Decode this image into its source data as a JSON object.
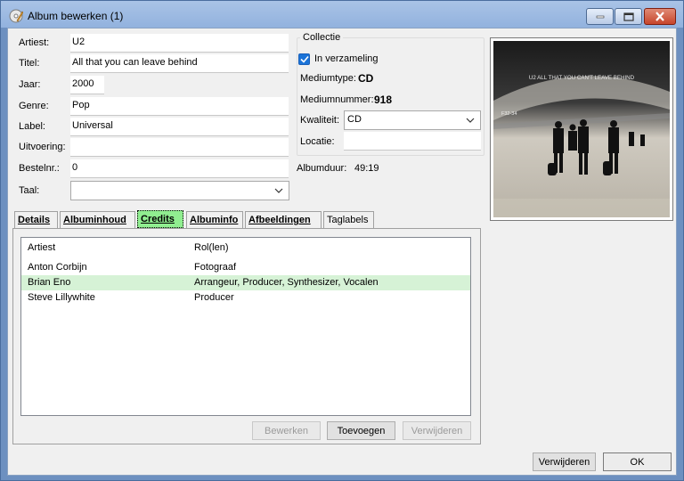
{
  "window": {
    "title": "Album bewerken (1)",
    "controls": {
      "minimize": "minimize",
      "maximize": "maximize",
      "close": "close"
    }
  },
  "form": {
    "artist_label": "Artiest:",
    "artist_value": "U2",
    "title_label": "Titel:",
    "title_value": "All that you can leave behind",
    "year_label": "Jaar:",
    "year_value": "2000",
    "genre_label": "Genre:",
    "genre_value": "Pop",
    "label_label": "Label:",
    "label_value": "Universal",
    "performance_label": "Uitvoering:",
    "performance_value": "",
    "ordernr_label": "Bestelnr.:",
    "ordernr_value": "0",
    "language_label": "Taal:",
    "language_value": ""
  },
  "collection": {
    "title": "Collectie",
    "in_collection_label": "In verzameling",
    "in_collection_checked": true,
    "media_type_label": "Mediumtype:",
    "media_type_value": "CD",
    "media_number_label": "Mediumnummer:",
    "media_number_value": "918",
    "quality_label": "Kwaliteit:",
    "quality_value": "CD",
    "location_label": "Locatie:",
    "location_value": ""
  },
  "duration": {
    "label": "Albumduur:",
    "value": "49:19"
  },
  "cover": {
    "caption": "U2 ALL THAT YOU CAN'T LEAVE BEHIND",
    "gate_sign": "F32-34"
  },
  "tabs": [
    {
      "label": "Details"
    },
    {
      "label": "Albuminhoud"
    },
    {
      "label": "Credits"
    },
    {
      "label": "Albuminfo"
    },
    {
      "label": "Afbeeldingen"
    },
    {
      "label": "Taglabels"
    }
  ],
  "credits": {
    "columns": [
      "Artiest",
      "Rol(len)"
    ],
    "rows": [
      {
        "artist": "Anton Corbijn",
        "roles": "Fotograaf"
      },
      {
        "artist": "Brian Eno",
        "roles": "Arrangeur, Producer, Synthesizer, Vocalen"
      },
      {
        "artist": "Steve Lillywhite",
        "roles": "Producer"
      }
    ],
    "selected_row": 1,
    "edit_label": "Bewerken",
    "add_label": "Toevoegen",
    "remove_label": "Verwijderen"
  },
  "footer": {
    "remove_label": "Verwijderen",
    "ok_label": "OK"
  },
  "colors": {
    "titlebar": "#92b2de",
    "accent_active_tab": "#90ee90",
    "selected_row": "#d6f2d6",
    "checkbox": "#1a73d8"
  }
}
